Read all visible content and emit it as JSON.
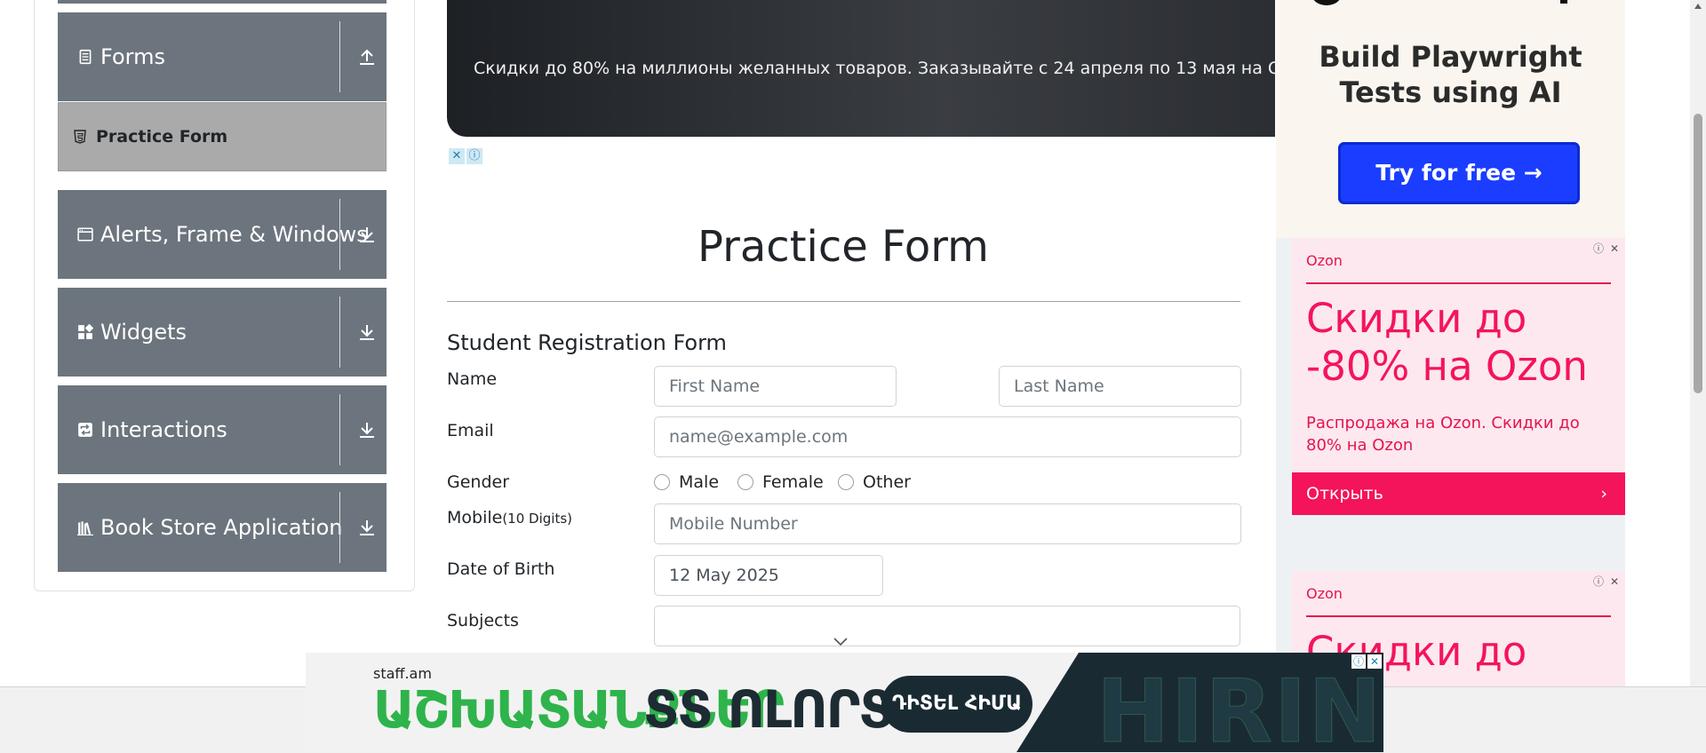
{
  "sidebar": {
    "groups": [
      {
        "label": "Forms",
        "icon": "document-icon",
        "expanded": true
      },
      {
        "label": "Alerts, Frame & Windows",
        "icon": "window-icon",
        "expanded": false
      },
      {
        "label": "Widgets",
        "icon": "widgets-icon",
        "expanded": false
      },
      {
        "label": "Interactions",
        "icon": "interactions-icon",
        "expanded": false
      },
      {
        "label": "Book Store Application",
        "icon": "books-icon",
        "expanded": false
      }
    ],
    "active_item": {
      "label": "Practice Form",
      "icon": "html5-icon"
    }
  },
  "top_banner": {
    "text": "Скидки до 80% на миллионы желанных товаров. Заказывайте с 24 апреля по 13 мая на Ozon"
  },
  "main": {
    "title": "Practice Form",
    "form_heading": "Student Registration Form",
    "labels": {
      "name": "Name",
      "email": "Email",
      "gender": "Gender",
      "mobile": "Mobile",
      "mobile_hint": "(10 Digits)",
      "dob": "Date of Birth",
      "subjects": "Subjects"
    },
    "placeholders": {
      "first_name": "First Name",
      "last_name": "Last Name",
      "email": "name@example.com",
      "mobile": "Mobile Number"
    },
    "dob_value": "12 May 2025",
    "gender_options": [
      "Male",
      "Female",
      "Other"
    ]
  },
  "right_ads": {
    "playwright": {
      "headline_line1": "Build Playwright",
      "headline_line2": "Tests using AI",
      "cta": "Try for free →"
    },
    "ozon1": {
      "brand": "Ozon",
      "big_line1": "Скидки до",
      "big_line2": "-80% на Ozon",
      "desc": "Распродажа на Ozon. Скидки до 80% на Ozon",
      "open": "Открыть"
    },
    "ozon2": {
      "brand": "Ozon",
      "big_line1": "Скидки до"
    }
  },
  "bottom_ad": {
    "logo": "staff.am",
    "text_green": "ԱՇԽԱՏԱՆՔՆԵՐ",
    "text_dark": "ՏՏ ՈԼՈՐՏՈՒՄ",
    "button": "ԴԻՏԵԼ ՀԻՄԱ",
    "bg_word": "HIRING"
  },
  "colors": {
    "sidebar_header": "#6c757d",
    "active_item": "#aaaaaa",
    "ozon_pink": "#f4145b",
    "cta_blue": "#1a3dff"
  }
}
